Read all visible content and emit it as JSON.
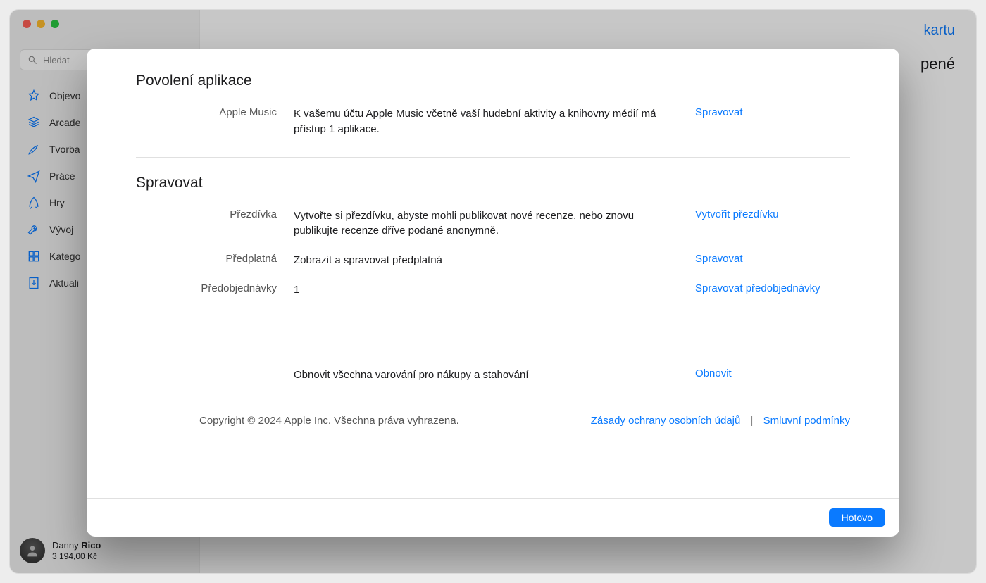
{
  "traffic": {
    "red": "#FF5F57",
    "yellow": "#FEBC2E",
    "green": "#28C840"
  },
  "search": {
    "placeholder": "Hledat"
  },
  "sidebar": {
    "items": [
      {
        "label": "Objevo"
      },
      {
        "label": "Arcade"
      },
      {
        "label": "Tvorba"
      },
      {
        "label": "Práce"
      },
      {
        "label": "Hry"
      },
      {
        "label": "Vývoj"
      },
      {
        "label": "Katego"
      },
      {
        "label": "Aktuali"
      }
    ]
  },
  "user": {
    "name_first": "Danny",
    "name_last": "Rico",
    "balance": "3 194,00 Kč"
  },
  "main": {
    "top_link_fragment": "kartu",
    "top_text_fragment": "pené"
  },
  "modal": {
    "section1_title": "Povolení aplikace",
    "apple_music_label": "Apple Music",
    "apple_music_value": "K vašemu účtu Apple Music včetně vaší hudební aktivity a knihovny médií má přístup 1 aplikace.",
    "apple_music_action": "Spravovat",
    "section2_title": "Spravovat",
    "nick_label": "Přezdívka",
    "nick_value": "Vytvořte si přezdívku, abyste mohli publikovat nové recenze, nebo znovu publikujte recenze dříve podané anonymně.",
    "nick_action": "Vytvořit přezdívku",
    "subs_label": "Předplatná",
    "subs_value": "Zobrazit a spravovat předplatná",
    "subs_action": "Spravovat",
    "preorders_label": "Předobjednávky",
    "preorders_value": "1",
    "preorders_action": "Spravovat předobjednávky",
    "reset_value": "Obnovit všechna varování pro nákupy a stahování",
    "reset_action": "Obnovit",
    "copyright": "Copyright © 2024 Apple Inc. Všechna práva vyhrazena.",
    "privacy": "Zásady ochrany osobních údajů",
    "terms": "Smluvní podmínky",
    "done": "Hotovo"
  }
}
